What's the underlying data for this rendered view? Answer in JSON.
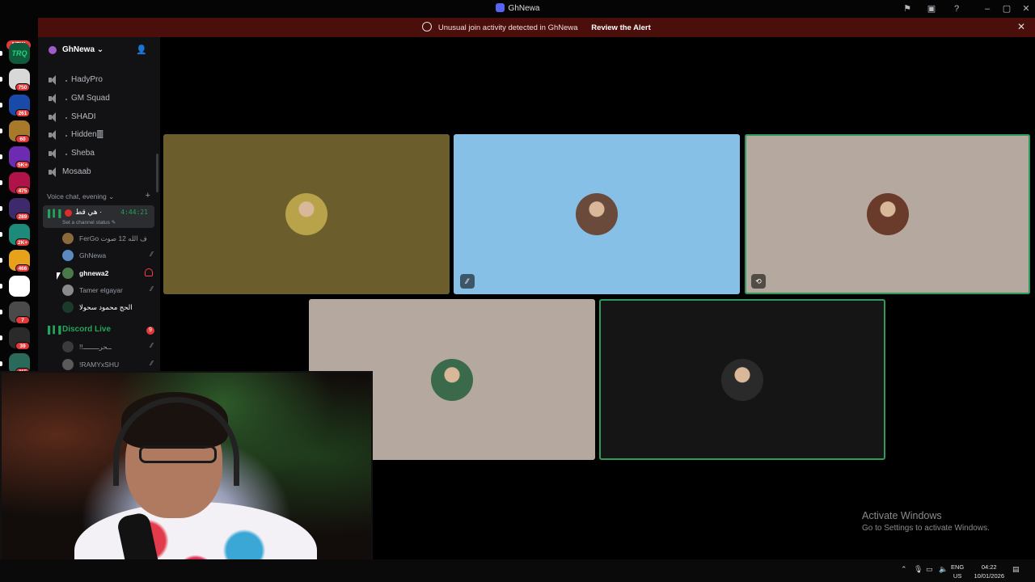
{
  "window": {
    "title": "GhNewa"
  },
  "alert": {
    "message": "Unusual join activity detected in GhNewa",
    "action": "Review the Alert"
  },
  "server_rail": {
    "new_badge": "NEW",
    "servers": [
      {
        "name": "TRQ",
        "color": "#0f5a3a",
        "badge": ""
      },
      {
        "color": "#d8d8d8",
        "badge": "750"
      },
      {
        "color": "#1a4aa8",
        "badge": "261"
      },
      {
        "color": "#a67a2a",
        "badge": "60"
      },
      {
        "color": "#6c2bb0",
        "badge": "5K+"
      },
      {
        "color": "#b0124a",
        "badge": "475"
      },
      {
        "color": "#3c2a6a",
        "badge": "289"
      },
      {
        "color": "#1e8a7a",
        "badge": "2K+"
      },
      {
        "color": "#e6a21a",
        "badge": "466"
      },
      {
        "color": "#ffffff",
        "badge": ""
      },
      {
        "color": "#4a4a4a",
        "badge": "7"
      },
      {
        "color": "#2a2a2a",
        "badge": "39"
      },
      {
        "color": "#2a6a5a",
        "badge": "415"
      }
    ]
  },
  "sidebar": {
    "guild_name": "GhNewa",
    "voice_channels": [
      {
        "label": "HadyPro",
        "dot": true
      },
      {
        "label": "GM Squad",
        "dot": true
      },
      {
        "label": "SHADI",
        "dot": true
      },
      {
        "label": "Hidden🀫",
        "dot": true
      },
      {
        "label": "Sheba",
        "dot": true
      },
      {
        "label": "Mosaab",
        "dot": false
      }
    ],
    "category": "Voice chat, evening",
    "active_channel": {
      "name": "هي قط ·",
      "time": "4:44:21",
      "status": "Set a channel status"
    },
    "members": [
      {
        "name": "FerGo ف الله 12 صوت",
        "color": "#8a6a3a"
      },
      {
        "name": "GhNewa",
        "color": "#5a8ac0"
      },
      {
        "name": "ghnewa2",
        "color": "#4a7a4a"
      },
      {
        "name": "Tamer elgayar",
        "color": "#8a8a8a"
      },
      {
        "name": "الحج محمود سحولا",
        "color": "#1a3a2a"
      }
    ],
    "live_channel": {
      "label": "Discord Live",
      "badge": "9"
    },
    "live_members": [
      {
        "name": "!!ــــ‎ــــ‎ــحر",
        "color": "#3a3a3a"
      },
      {
        "name": "!RAMYxSHU",
        "color": "#5a5a5a"
      }
    ]
  },
  "tiles": [
    {
      "bg": "#6b5e2c",
      "avatar": "#b8a24a",
      "indicator": ""
    },
    {
      "bg": "#87c0e6",
      "avatar": "#6a4a3a",
      "indicator": "mute"
    },
    {
      "bg": "#b5a89e",
      "avatar": "#6a3a2a",
      "indicator": "share"
    },
    {
      "bg": "#b5a89e",
      "avatar": "#3a6a4a",
      "indicator": ""
    },
    {
      "bg": "#151515",
      "avatar": "#2a2a2a",
      "indicator": ""
    }
  ],
  "activation": {
    "title": "Activate Windows",
    "subtitle": "Go to Settings to activate Windows."
  },
  "taskbar": {
    "lang1": "ENG",
    "lang2": "US",
    "time": "04:22",
    "date": "10/01/2026"
  }
}
